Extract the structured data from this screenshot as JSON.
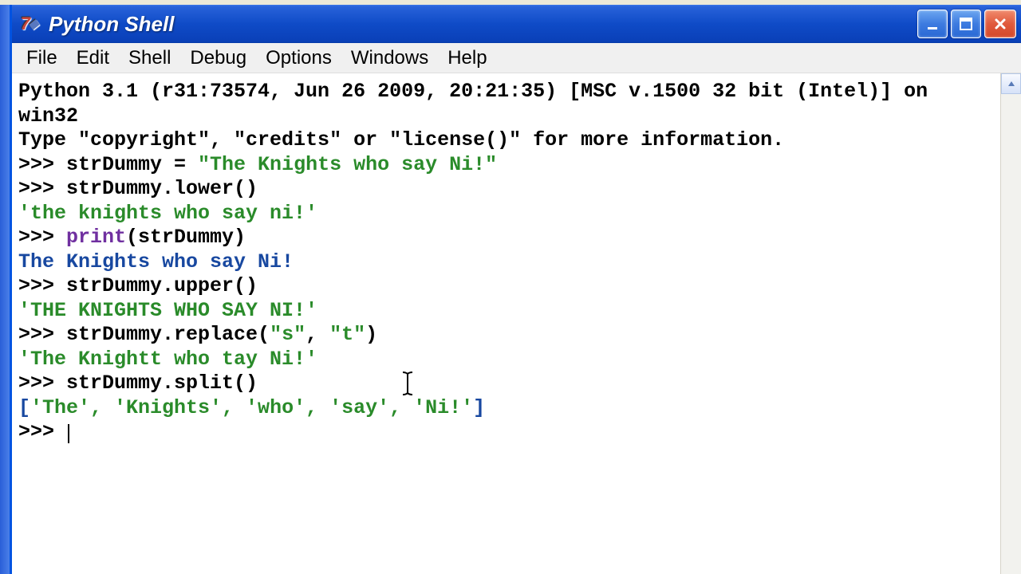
{
  "window": {
    "title": "Python Shell"
  },
  "menu": {
    "file": "File",
    "edit": "Edit",
    "shell": "Shell",
    "debug": "Debug",
    "options": "Options",
    "windows": "Windows",
    "help": "Help"
  },
  "terminal": {
    "banner_line1": "Python 3.1 (r31:73574, Jun 26 2009, 20:21:35) [MSC v.1500 32 bit (Intel)] on win32",
    "banner_line2": "Type \"copyright\", \"credits\" or \"license()\" for more information.",
    "prompt": ">>> ",
    "lines": {
      "l1_code": "strDummy = ",
      "l1_str": "\"The Knights who say Ni!\"",
      "l2_code": "strDummy.lower()",
      "l2_out": "'the knights who say ni!'",
      "l3_func": "print",
      "l3_rest": "(strDummy)",
      "l3_out": "The Knights who say Ni!",
      "l4_code": "strDummy.upper()",
      "l4_out": "'THE KNIGHTS WHO SAY NI!'",
      "l5_code_a": "strDummy.replace(",
      "l5_str_a": "\"s\"",
      "l5_sep": ", ",
      "l5_str_b": "\"t\"",
      "l5_code_b": ")",
      "l5_out": "'The Knightt who tay Ni!'",
      "l6_code": "strDummy.split()",
      "l6_out_open": "[",
      "l6_out_items": "'The', 'Knights', 'who', 'say', 'Ni!'",
      "l6_out_close": "]"
    }
  }
}
